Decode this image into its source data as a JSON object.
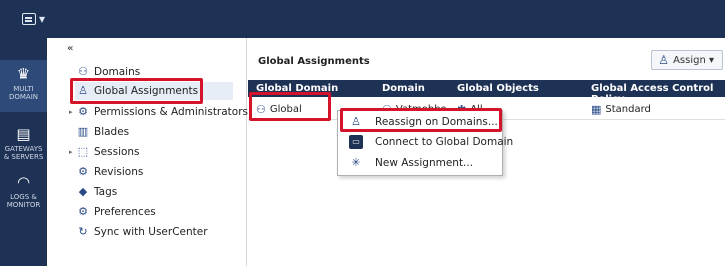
{
  "app_menu": {
    "label": "Q⁄"
  },
  "leftnav": {
    "items": [
      {
        "label_line1": "MULTI",
        "label_line2": "DOMAIN",
        "icon": "crown-icon"
      },
      {
        "label_line1": "GATEWAYS",
        "label_line2": "& SERVERS",
        "icon": "server-icon"
      },
      {
        "label_line1": "LOGS &",
        "label_line2": "MONITOR",
        "icon": "gauge-icon"
      }
    ]
  },
  "tree": {
    "collapse": "«",
    "items": [
      {
        "label": "Domains"
      },
      {
        "label": "Global Assignments"
      },
      {
        "label": "Permissions & Administrators"
      },
      {
        "label": "Blades"
      },
      {
        "label": "Sessions"
      },
      {
        "label": "Revisions"
      },
      {
        "label": "Tags"
      },
      {
        "label": "Preferences"
      },
      {
        "label": "Sync with UserCenter"
      }
    ]
  },
  "content": {
    "title": "Global Assignments",
    "assign_button": "Assign ▾",
    "columns": [
      "Global Domain",
      "Domain",
      "Global Objects",
      "Global Access Control Policy"
    ],
    "row": {
      "global_domain": "Global",
      "domain": "Vatmobbo",
      "global_objects": "All",
      "policy": "Standard"
    }
  },
  "context_menu": {
    "items": [
      {
        "label": "Reassign on Domains..."
      },
      {
        "label": "Connect to Global Domain"
      },
      {
        "label": "New Assignment..."
      }
    ]
  },
  "colors": {
    "nav_bg": "#1e3256",
    "highlight": "#d3142a"
  }
}
